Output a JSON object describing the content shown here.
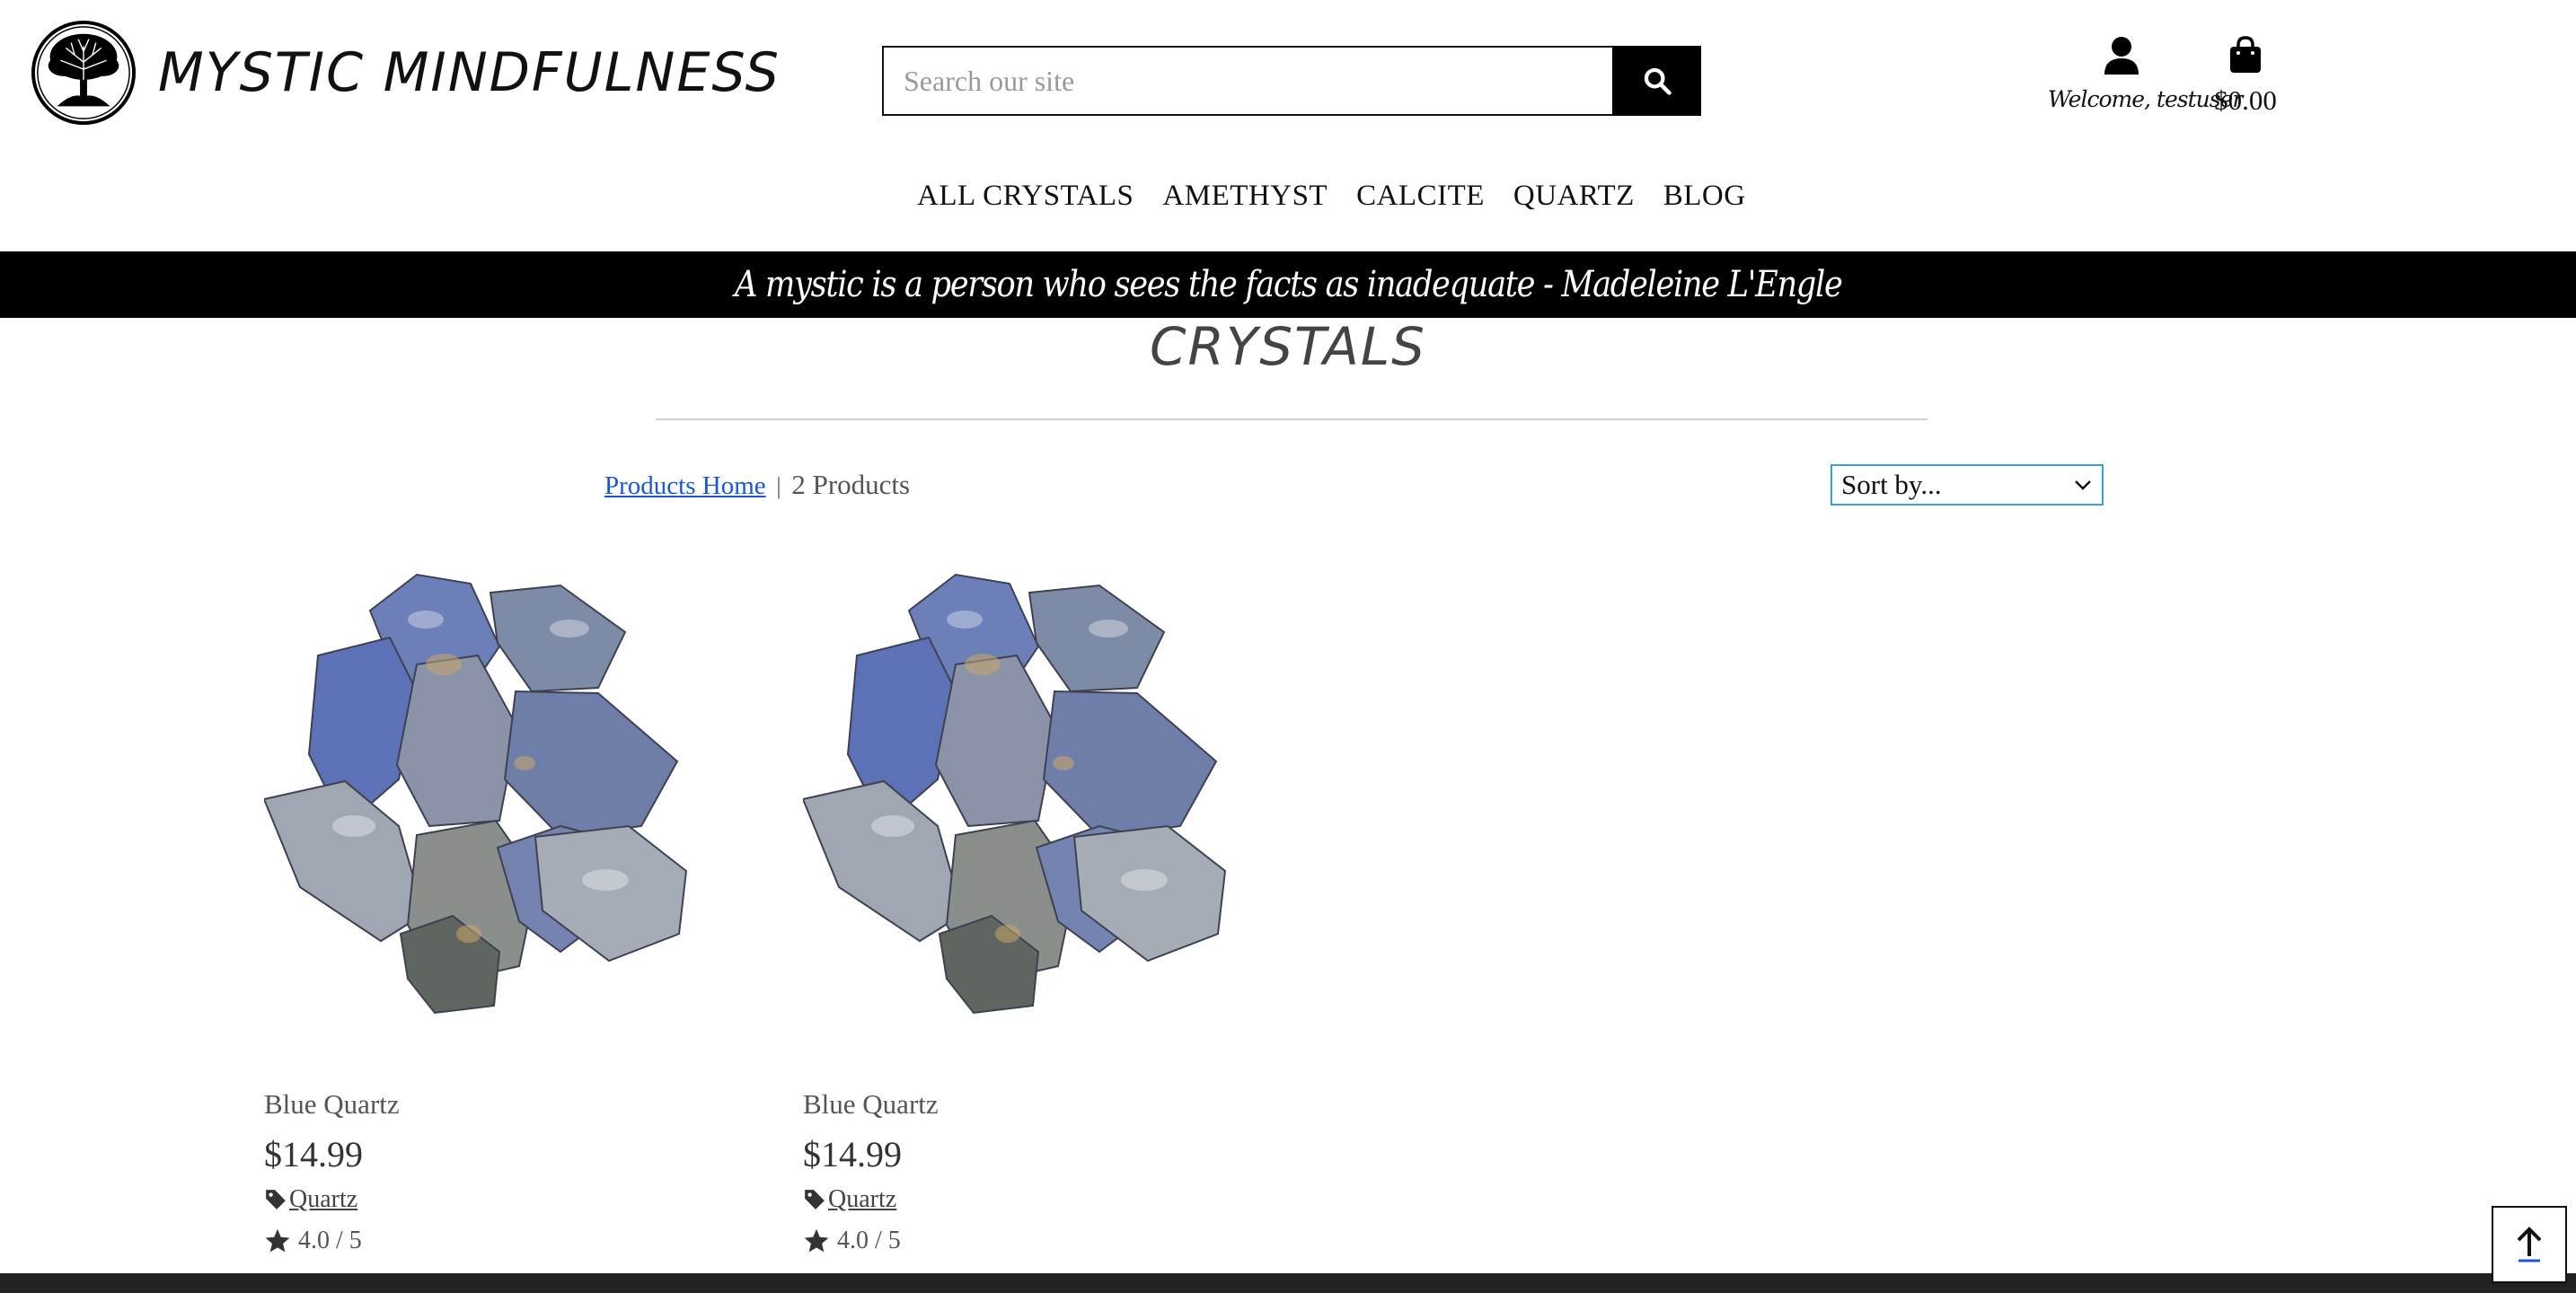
{
  "header": {
    "brand": "MYSTIC MINDFULNESS",
    "search_placeholder": "Search our site",
    "account_label": "Welcome, testuser",
    "bag_total": "$0.00"
  },
  "nav": {
    "items": [
      "ALL CRYSTALS",
      "AMETHYST",
      "CALCITE",
      "QUARTZ",
      "BLOG"
    ]
  },
  "banner": {
    "text": "A mystic is a person who sees the facts as inadequate - Madeleine L'Engle"
  },
  "page": {
    "title": "CRYSTALS",
    "breadcrumb_link": "Products Home",
    "separator": "|",
    "product_count": "2 Products",
    "sort_label": "Sort by..."
  },
  "products": [
    {
      "name": "Blue Quartz",
      "price": "$14.99",
      "category": "Quartz",
      "rating": "4.0 / 5"
    },
    {
      "name": "Blue Quartz",
      "price": "$14.99",
      "category": "Quartz",
      "rating": "4.0 / 5"
    }
  ],
  "icons": {
    "logo": "tree-of-life-logo",
    "search": "search-icon",
    "account": "user-icon",
    "bag": "shopping-bag-icon",
    "tag": "tag-icon",
    "rating": "star-icon",
    "back_to_top": "arrow-up-icon"
  },
  "colors": {
    "banner_bg": "#000000",
    "link": "#1a56db",
    "sort_border": "#3aa0d8",
    "footer": "#222222"
  }
}
